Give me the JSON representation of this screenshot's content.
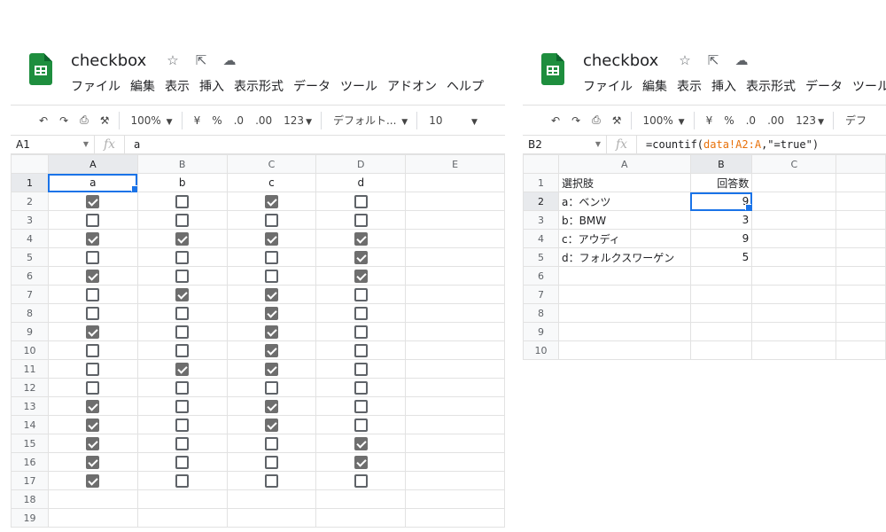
{
  "left": {
    "title": "checkbox",
    "menu": [
      "ファイル",
      "編集",
      "表示",
      "挿入",
      "表示形式",
      "データ",
      "ツール",
      "アドオン",
      "ヘルプ"
    ],
    "toolbar": {
      "zoom": "100%",
      "currency": "¥",
      "percent": "%",
      "dec_less": ".0",
      "dec_more": ".00",
      "format123": "123",
      "font": "デフォルト...",
      "font_size": "10"
    },
    "name_box": "A1",
    "formula": "a",
    "columns": [
      "A",
      "B",
      "C",
      "D",
      "E"
    ],
    "header_row": [
      "a",
      "b",
      "c",
      "d"
    ],
    "checkboxes": [
      [
        true,
        false,
        true,
        false
      ],
      [
        false,
        false,
        false,
        false
      ],
      [
        true,
        true,
        true,
        true
      ],
      [
        false,
        false,
        false,
        true
      ],
      [
        true,
        false,
        false,
        true
      ],
      [
        false,
        true,
        true,
        false
      ],
      [
        false,
        false,
        true,
        false
      ],
      [
        true,
        false,
        true,
        false
      ],
      [
        false,
        false,
        true,
        false
      ],
      [
        false,
        true,
        true,
        false
      ],
      [
        false,
        false,
        false,
        false
      ],
      [
        true,
        false,
        true,
        false
      ],
      [
        true,
        false,
        true,
        false
      ],
      [
        true,
        false,
        false,
        true
      ],
      [
        true,
        false,
        false,
        true
      ],
      [
        true,
        false,
        false,
        false
      ]
    ],
    "row_numbers": [
      "1",
      "2",
      "3",
      "4",
      "5",
      "6",
      "7",
      "8",
      "9",
      "10",
      "11",
      "12",
      "13",
      "14",
      "15",
      "16",
      "17",
      "18",
      "19"
    ]
  },
  "right": {
    "title": "checkbox",
    "menu": [
      "ファイル",
      "編集",
      "表示",
      "挿入",
      "表示形式",
      "データ",
      "ツール"
    ],
    "toolbar": {
      "zoom": "100%",
      "currency": "¥",
      "percent": "%",
      "dec_less": ".0",
      "dec_more": ".00",
      "format123": "123",
      "font": "デフ"
    },
    "name_box": "B2",
    "formula_prefix": "=countif(",
    "formula_ref": "data!A2:A",
    "formula_suffix": ",\"=true\")",
    "columns": [
      "A",
      "B",
      "C"
    ],
    "rows": [
      {
        "a": "選択肢",
        "b": "回答数"
      },
      {
        "a": "a：ベンツ",
        "b": "9"
      },
      {
        "a": "b：BMW",
        "b": "3"
      },
      {
        "a": "c：アウディ",
        "b": "9"
      },
      {
        "a": "d：フォルクスワーゲン",
        "b": "5"
      },
      {
        "a": "",
        "b": ""
      },
      {
        "a": "",
        "b": ""
      },
      {
        "a": "",
        "b": ""
      },
      {
        "a": "",
        "b": ""
      },
      {
        "a": "",
        "b": ""
      }
    ],
    "row_numbers": [
      "1",
      "2",
      "3",
      "4",
      "5",
      "6",
      "7",
      "8",
      "9",
      "10"
    ]
  }
}
